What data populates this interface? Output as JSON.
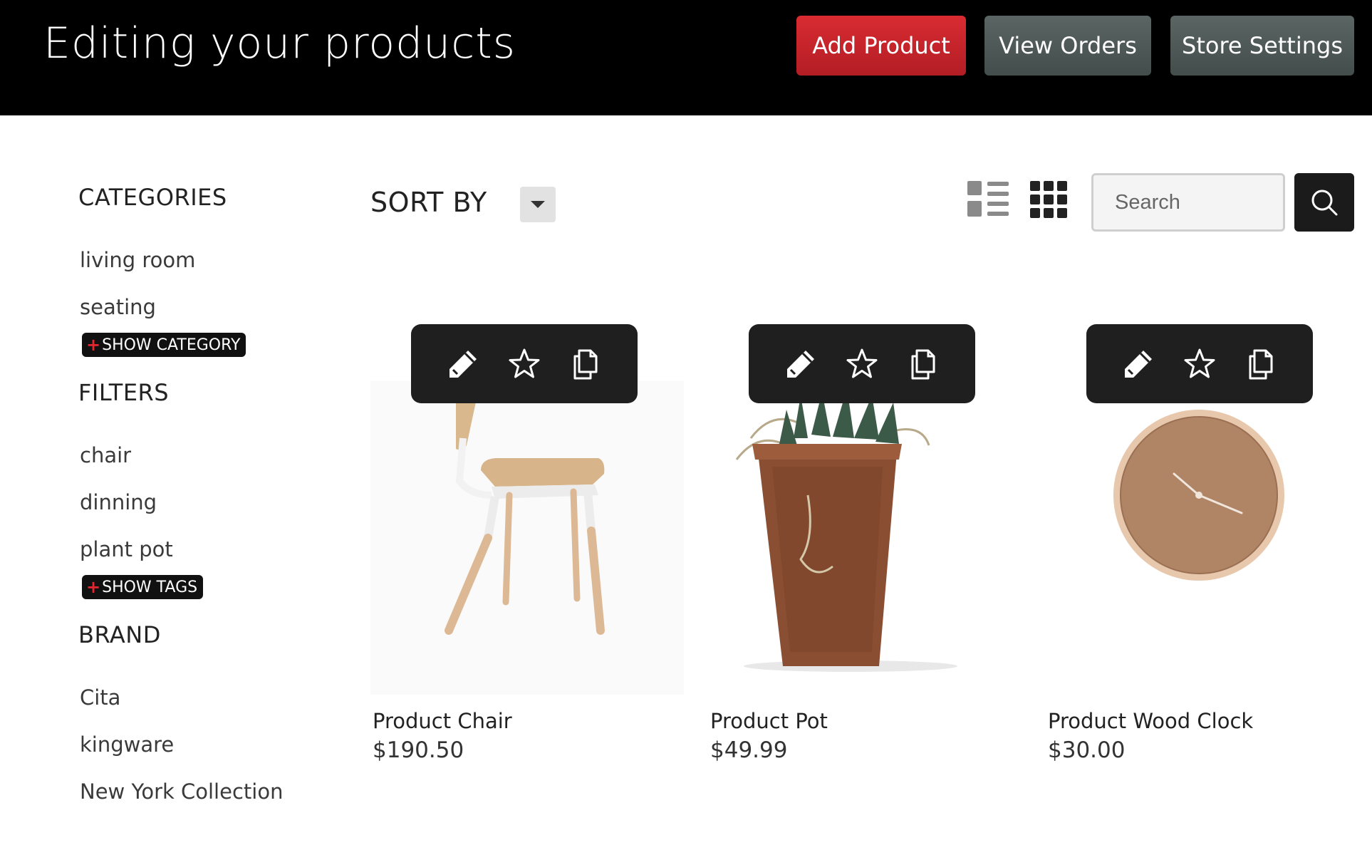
{
  "header": {
    "title": "Editing your products",
    "buttons": {
      "add_product": "Add Product",
      "view_orders": "View Orders",
      "store_settings": "Store Settings"
    }
  },
  "sidebar": {
    "categories": {
      "heading": "CATEGORIES",
      "items": [
        "living room",
        "seating"
      ],
      "show_more": "SHOW CATEGORY"
    },
    "filters": {
      "heading": "FILTERS",
      "items": [
        "chair",
        "dinning",
        "plant pot"
      ],
      "show_more": "SHOW TAGS"
    },
    "brand": {
      "heading": "BRAND",
      "items": [
        "Cita",
        "kingware",
        "New York Collection"
      ]
    },
    "show_more_prefix": "+"
  },
  "toolbar": {
    "sort_label": "SORT BY",
    "search_placeholder": "Search",
    "icons": [
      "list-view-icon",
      "grid-view-icon",
      "search-icon"
    ]
  },
  "products": [
    {
      "name": "Product Chair",
      "price": "$190.50",
      "image": "chair"
    },
    {
      "name": "Product Pot",
      "price": "$49.99",
      "image": "plant-pot"
    },
    {
      "name": "Product Wood Clock",
      "price": "$30.00",
      "image": "wood-clock"
    }
  ],
  "card_actions": [
    "edit-icon",
    "star-icon",
    "duplicate-icon"
  ],
  "colors": {
    "header_bg": "#000000",
    "add_button": "#c8232a",
    "secondary_button": "#4f5958",
    "pill_bg": "#111111",
    "pill_plus": "#e3262f"
  }
}
